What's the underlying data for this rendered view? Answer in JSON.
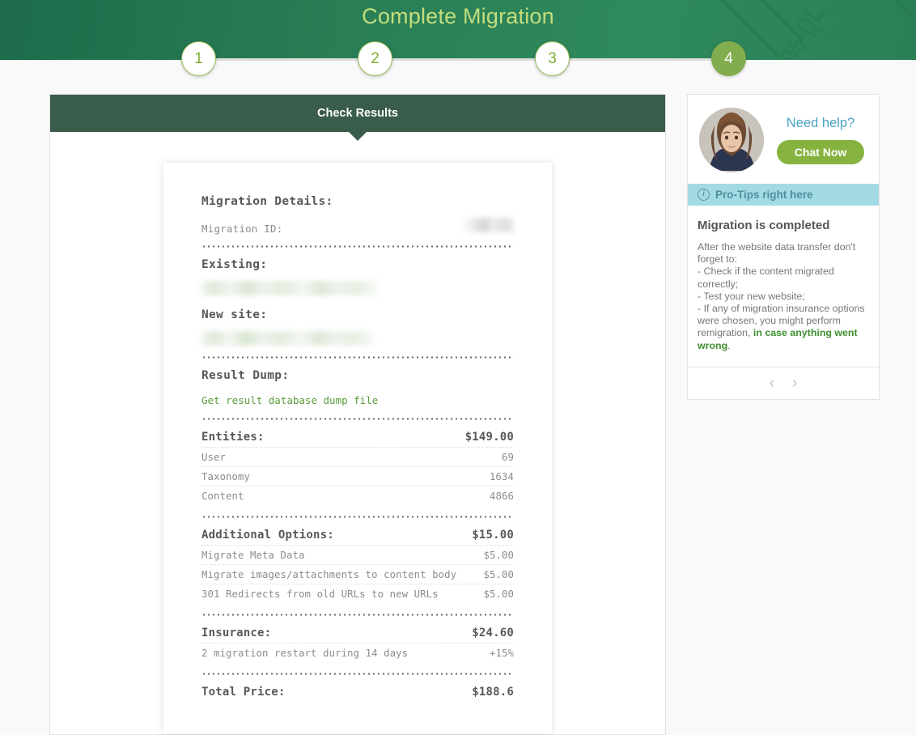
{
  "header": {
    "title": "Complete Migration"
  },
  "steps": [
    {
      "label": "1",
      "active": false
    },
    {
      "label": "2",
      "active": false
    },
    {
      "label": "3",
      "active": false
    },
    {
      "label": "4",
      "active": true
    }
  ],
  "main": {
    "panel_title": "Check Results",
    "receipt": {
      "details_title": "Migration Details:",
      "migration_id_label": "Migration ID:",
      "migration_id_value": "",
      "existing_label": "Existing:",
      "existing_value": "",
      "new_site_label": "New site:",
      "new_site_value": "",
      "result_dump_title": "Result Dump:",
      "result_dump_link": "Get result database dump file",
      "sections": [
        {
          "title": "Entities:",
          "amount": "$149.00",
          "rows": [
            {
              "label": "User",
              "value": "69"
            },
            {
              "label": "Taxonomy",
              "value": "1634"
            },
            {
              "label": "Content",
              "value": "4866"
            }
          ]
        },
        {
          "title": "Additional Options:",
          "amount": "$15.00",
          "rows": [
            {
              "label": "Migrate Meta Data",
              "value": "$5.00"
            },
            {
              "label": "Migrate images/attachments to content body",
              "value": "$5.00"
            },
            {
              "label": "301 Redirects from old URLs to new URLs",
              "value": "$5.00"
            }
          ]
        },
        {
          "title": "Insurance:",
          "amount": "$24.60",
          "rows": [
            {
              "label": "2 migration restart during 14 days",
              "value": "+15%"
            }
          ]
        }
      ],
      "total_label": "Total Price:",
      "total_value": "$188.6"
    }
  },
  "sidebar": {
    "need_help_text": "Need help?",
    "chat_button": "Chat Now",
    "protips_bar": "Pro-Tips right here",
    "tips_title": "Migration is completed",
    "tips_text_part1": "After the website data transfer don't forget to:",
    "tips_text_part2": "- Check if the content migrated correctly;",
    "tips_text_part3": "- Test your new website;",
    "tips_text_part4": "- If any of migration insurance options were chosen, you might perform remigration, ",
    "tips_link": "in case anything went wrong",
    "tips_text_end": ".",
    "prev_arrow": "‹",
    "next_arrow": "›"
  },
  "colors": {
    "header_green": "#2a7f56",
    "title_yellow_green": "#c5dd7c",
    "panel_header_dark": "#3a5c4b",
    "accent_green": "#86b33f",
    "teal": "#4aa3c4",
    "protips_cyan": "#a3dbe4",
    "link_green": "#5a9b3c"
  }
}
